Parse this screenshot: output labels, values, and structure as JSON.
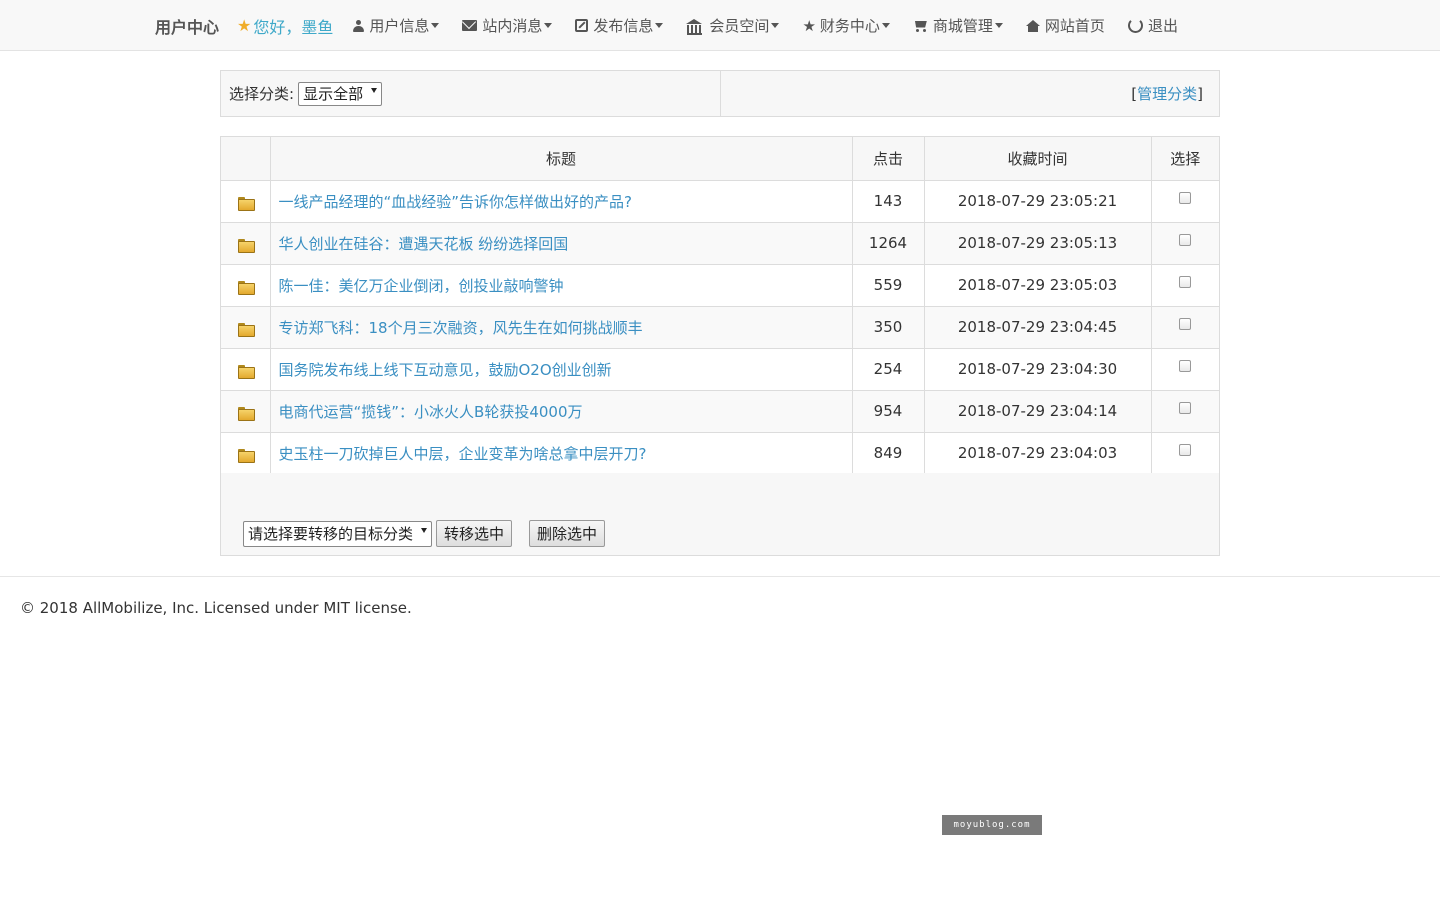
{
  "nav": {
    "brand": "用户中心",
    "greeting": "您好，墨鱼",
    "items": [
      {
        "label": "用户信息",
        "icon": "user-icon",
        "dropdown": true
      },
      {
        "label": "站内消息",
        "icon": "envelope-icon",
        "dropdown": true
      },
      {
        "label": "发布信息",
        "icon": "edit-icon",
        "dropdown": true
      },
      {
        "label": "会员空间",
        "icon": "bank-icon",
        "dropdown": true
      },
      {
        "label": "财务中心",
        "icon": "star-icon",
        "dropdown": true
      },
      {
        "label": "商城管理",
        "icon": "cart-icon",
        "dropdown": true
      },
      {
        "label": "网站首页",
        "icon": "home-icon",
        "dropdown": false
      },
      {
        "label": "退出",
        "icon": "power-icon",
        "dropdown": false
      }
    ]
  },
  "filter": {
    "label": "选择分类:",
    "selected": "显示全部",
    "manage_open": "[",
    "manage_link": "管理分类",
    "manage_close": "]"
  },
  "table": {
    "headers": [
      "",
      "标题",
      "点击",
      "收藏时间",
      "选择"
    ],
    "rows": [
      {
        "title": "一线产品经理的“血战经验”告诉你怎样做出好的产品?",
        "clicks": "143",
        "time": "2018-07-29 23:05:21"
      },
      {
        "title": "华人创业在硅谷：遭遇天花板 纷纷选择回国",
        "clicks": "1264",
        "time": "2018-07-29 23:05:13"
      },
      {
        "title": "陈一佳：美亿万企业倒闭，创投业敲响警钟",
        "clicks": "559",
        "time": "2018-07-29 23:05:03"
      },
      {
        "title": "专访郑飞科：18个月三次融资，风先生在如何挑战顺丰",
        "clicks": "350",
        "time": "2018-07-29 23:04:45"
      },
      {
        "title": "国务院发布线上线下互动意见，鼓励O2O创业创新",
        "clicks": "254",
        "time": "2018-07-29 23:04:30"
      },
      {
        "title": "电商代运营“揽钱”：小冰火人B轮获投4000万",
        "clicks": "954",
        "time": "2018-07-29 23:04:14"
      },
      {
        "title": "史玉柱一刀砍掉巨人中层，企业变革为啥总拿中层开刀?",
        "clicks": "849",
        "time": "2018-07-29 23:04:03"
      }
    ]
  },
  "actions": {
    "target_select": "请选择要转移的目标分类",
    "move_button": "转移选中",
    "delete_button": "删除选中"
  },
  "footer": {
    "copyright": "© 2018 AllMobilize, Inc. Licensed under MIT license."
  },
  "watermark": "moyublog.com",
  "colors": {
    "link": "#3a8fc2",
    "greeting": "#3fa9c9",
    "star": "#f0ad2a"
  }
}
